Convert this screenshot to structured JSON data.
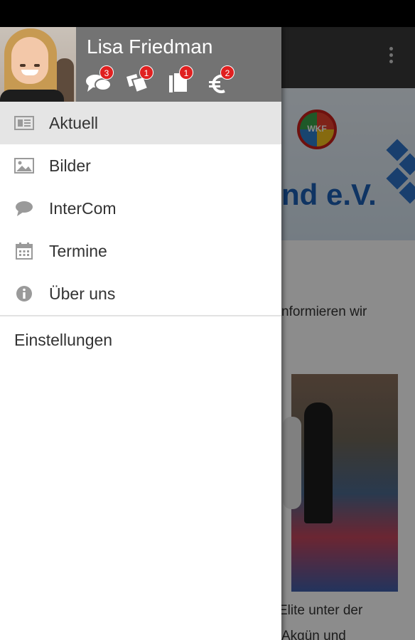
{
  "user": {
    "name": "Lisa Friedman",
    "badges": {
      "messages": "3",
      "tickets": "1",
      "documents": "1",
      "payments": "2"
    }
  },
  "menu": {
    "items": [
      {
        "label": "Aktuell",
        "icon": "news-icon"
      },
      {
        "label": "Bilder",
        "icon": "image-icon"
      },
      {
        "label": "InterCom",
        "icon": "chat-bubble-icon"
      },
      {
        "label": "Termine",
        "icon": "calendar-icon"
      },
      {
        "label": "Über uns",
        "icon": "info-icon"
      }
    ],
    "settings_label": "Einstellungen"
  },
  "background": {
    "banner_text": "nd e.V.",
    "logo_text": "WKF",
    "line1": "nformieren wir",
    "line2": "Elite unter der",
    "line3": "Akgün und"
  },
  "colors": {
    "header_bg": "#737373",
    "badge": "#e02020",
    "active_item_bg": "#e5e5e5"
  }
}
